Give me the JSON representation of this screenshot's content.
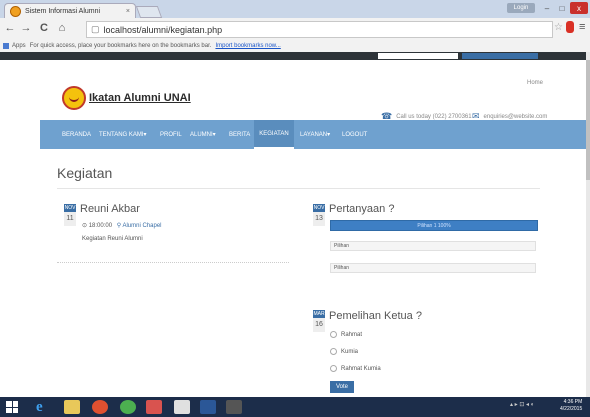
{
  "browser": {
    "tab_title": "Sistem Informasi Alumni",
    "tab_close": "×",
    "user_button": "Login",
    "win_min": "–",
    "win_max": "□",
    "win_close": "x",
    "back": "←",
    "forward": "→",
    "reload": "C",
    "home": "⌂",
    "page_icon": "▢",
    "url": "localhost/alumni/kegiatan.php",
    "star": "☆",
    "menu": "≡",
    "bookmarks_apps": "Apps",
    "bookmarks_text": "For quick access, place your bookmarks here on the bookmarks bar.",
    "bookmarks_link": "Import bookmarks now..."
  },
  "header": {
    "brand": "Ikatan Alumni UNAI",
    "home_link": "Home",
    "phone": "Call us today (022) 2700361",
    "email": "enquiries@website.com",
    "phone_icon": "phone-icon",
    "email_icon": "envelope-icon"
  },
  "nav": {
    "items": [
      {
        "label": "BERANDA"
      },
      {
        "label": "TENTANG KAMI▾"
      },
      {
        "label": "PROFIL"
      },
      {
        "label": "ALUMNI▾"
      },
      {
        "label": "BERITA"
      },
      {
        "label": "KEGIATAN"
      },
      {
        "label": "LAYANAN▾"
      },
      {
        "label": "LOGOUT"
      }
    ]
  },
  "page": {
    "title": "Kegiatan"
  },
  "events": [
    {
      "month": "NOV",
      "day": "11",
      "title": "Reuni Akbar",
      "time": "⊙ 18:00:00",
      "place": "⚲ Alumni Chapel",
      "desc": "Kegiatan Reuni Alumni"
    }
  ],
  "polls": [
    {
      "month": "NOV",
      "day": "13",
      "title": "Pertanyaan ?",
      "progress_label": "Pilihan 1 100%",
      "progress": 1.0,
      "options": [
        "Pilihan",
        "Pilihan"
      ]
    },
    {
      "month": "MAR",
      "day": "16",
      "title": "Pemelihan Ketua ?",
      "options": [
        "Rahmat",
        "Kumia",
        "Rahmat Kumia"
      ],
      "vote_label": "Vote"
    }
  ],
  "taskbar": {
    "clock_time": "4:36 PM",
    "clock_date": "4/22/2015",
    "tray": "▴ ▸ ⊡ ◂ ◐"
  }
}
